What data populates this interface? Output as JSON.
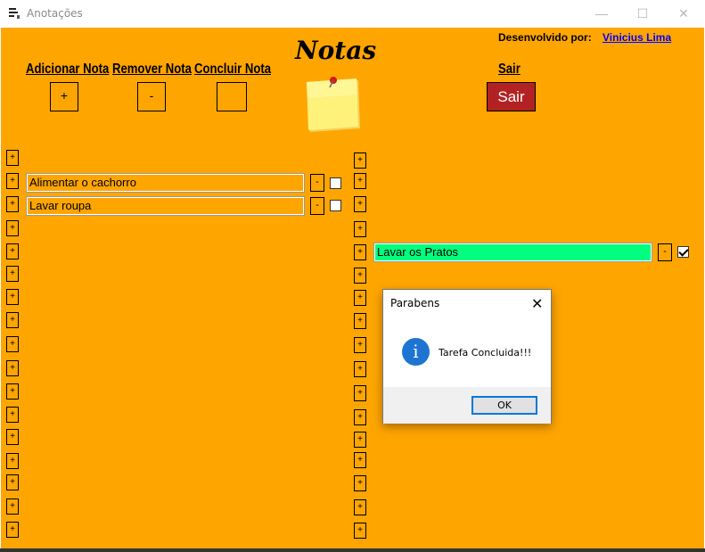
{
  "window": {
    "title": "Anotações",
    "minimize_icon": "minimize-icon",
    "maximize_icon": "maximize-icon",
    "close_icon": "close-icon"
  },
  "credits": {
    "label": "Desenvolvido por:",
    "author_link": "Vinicius Lima"
  },
  "toolbar": {
    "add_label": "Adicionar Nota",
    "add_button": "+",
    "remove_label": "Remover Nota",
    "remove_button": "-",
    "conclude_label": "Concluir Nota",
    "conclude_button": "",
    "exit_label": "Sair",
    "exit_button": "Sair"
  },
  "logo": {
    "title": "Notas",
    "image_icon": "sticky-note-icon"
  },
  "left_column": {
    "plus_label": "+",
    "notes": [
      {
        "text": "Alimentar o cachorro",
        "remove": "-",
        "checked": false
      },
      {
        "text": "Lavar roupa",
        "remove": "-",
        "checked": false
      }
    ]
  },
  "right_column": {
    "plus_label": "+",
    "notes": [
      {
        "text": "Lavar os Pratos",
        "remove": "-",
        "checked": true
      }
    ]
  },
  "dialog": {
    "title": "Parabens",
    "message": "Tarefa Concluida!!!",
    "ok_label": "OK",
    "icon": "info-icon",
    "accent": "#1e74d2"
  },
  "colors": {
    "background": "#ffa500",
    "done_note": "#00ff7f",
    "exit_button": "#b22222"
  }
}
